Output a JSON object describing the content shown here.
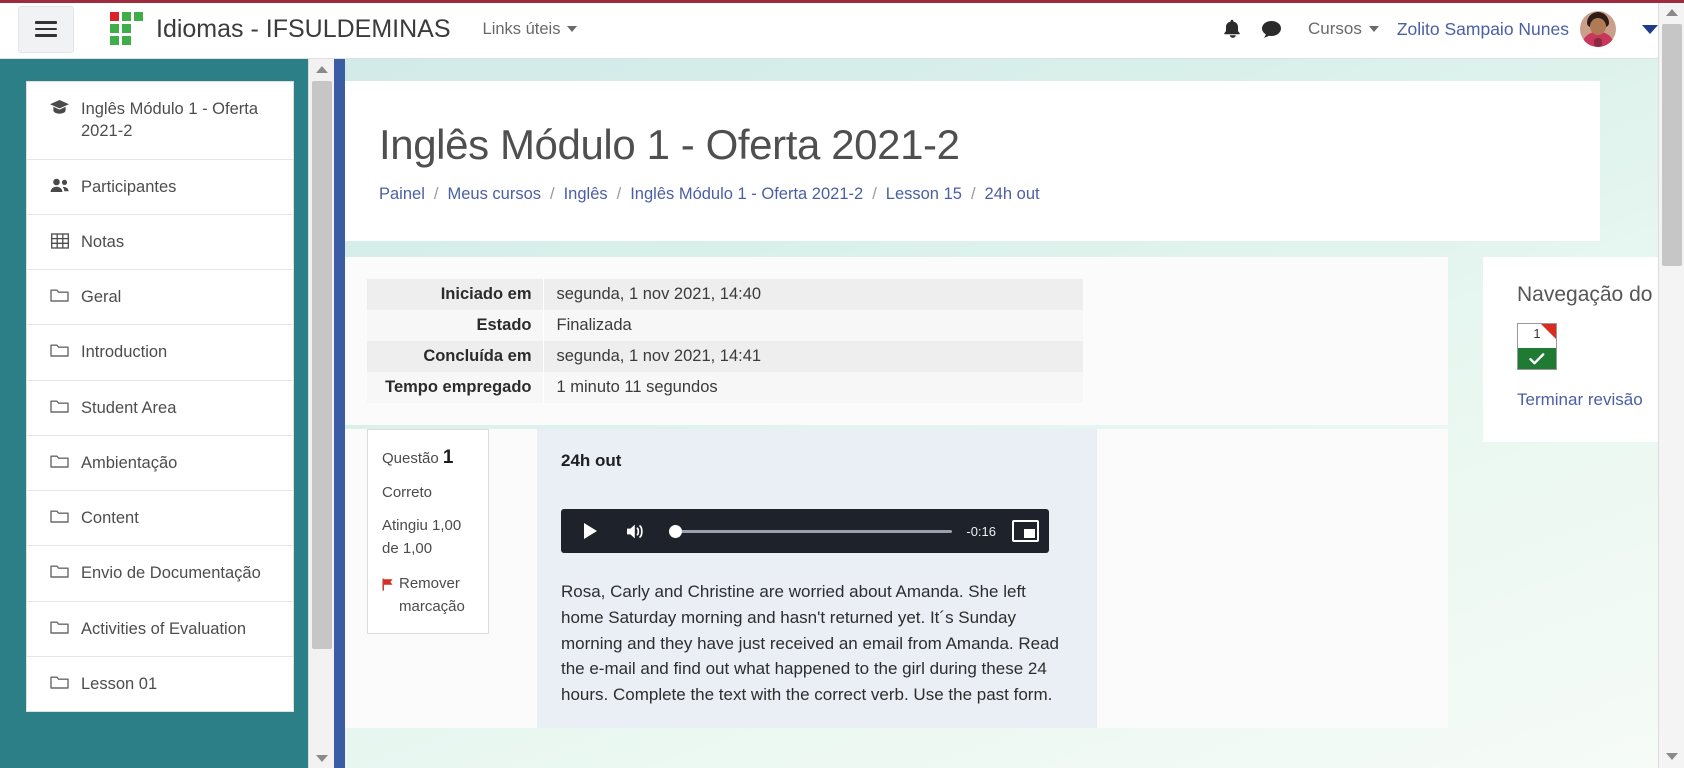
{
  "navbar": {
    "menu_toggle_icon": "hamburger-icon",
    "brand_title": "Idiomas - IFSULDEMINAS",
    "links_label": "Links úteis",
    "notifications_icon": "bell-icon",
    "messages_icon": "message-bubble-icon",
    "courses_label": "Cursos",
    "user_name": "Zolito Sampaio Nunes",
    "avatar_icon": "user-avatar",
    "user_caret_icon": "chevron-down-icon"
  },
  "drawer": {
    "items": [
      {
        "label": "Inglês Módulo 1 - Oferta 2021-2",
        "icon": "graduation-cap-icon"
      },
      {
        "label": "Participantes",
        "icon": "users-icon"
      },
      {
        "label": "Notas",
        "icon": "grid-table-icon"
      },
      {
        "label": "Geral",
        "icon": "folder-icon"
      },
      {
        "label": "Introduction",
        "icon": "folder-icon"
      },
      {
        "label": "Student Area",
        "icon": "folder-icon"
      },
      {
        "label": "Ambientação",
        "icon": "folder-icon"
      },
      {
        "label": "Content",
        "icon": "folder-icon"
      },
      {
        "label": "Envio de Documentação",
        "icon": "folder-icon"
      },
      {
        "label": "Activities of Evaluation",
        "icon": "folder-icon"
      },
      {
        "label": "Lesson 01",
        "icon": "folder-icon"
      }
    ]
  },
  "header": {
    "title": "Inglês Módulo 1 - Oferta 2021-2",
    "breadcrumb": [
      "Painel",
      "Meus cursos",
      "Inglês",
      "Inglês Módulo 1 - Oferta 2021-2",
      "Lesson 15",
      "24h out"
    ],
    "breadcrumb_separator": "/"
  },
  "attempt": {
    "rows": [
      {
        "label": "Iniciado em",
        "value": "segunda, 1 nov 2021, 14:40"
      },
      {
        "label": "Estado",
        "value": "Finalizada"
      },
      {
        "label": "Concluída em",
        "value": "segunda, 1 nov 2021, 14:41"
      },
      {
        "label": "Tempo empregado",
        "value": "1 minuto 11 segundos"
      }
    ]
  },
  "question": {
    "number_label": "Questão",
    "number": "1",
    "status": "Correto",
    "grade": "Atingiu 1,00 de 1,00",
    "flag_action": "Remover marcação",
    "flag_icon": "flag-icon",
    "title": "24h out",
    "text": "Rosa, Carly and Christine are worried about Amanda. She left home Saturday morning and hasn't returned yet. It´s Sunday morning and they have just received an email from Amanda. Read the e-mail and find out what happened to the girl during these 24 hours. Complete the text with the correct verb. Use the past form."
  },
  "player": {
    "play_icon": "play-icon",
    "volume_icon": "volume-icon",
    "time_remaining": "-0:16",
    "pip_icon": "picture-in-picture-icon",
    "progress_percent": 0
  },
  "quiz_nav": {
    "title": "Navegação do questionário",
    "buttons": [
      {
        "label": "1",
        "flagged": true,
        "state_icon": "check-icon",
        "state": "correct"
      }
    ],
    "finish_link": "Terminar revisão"
  },
  "scrollbars": {
    "up_icon": "triangle-up-icon",
    "down_icon": "triangle-down-icon"
  },
  "colors": {
    "drawer_bg": "#2c7f87",
    "accent_link": "#4a5fa5",
    "correct_green": "#1f7a33",
    "flag_red": "#d62d20",
    "question_bg": "#e9eff5",
    "player_bg": "#1e222b"
  }
}
